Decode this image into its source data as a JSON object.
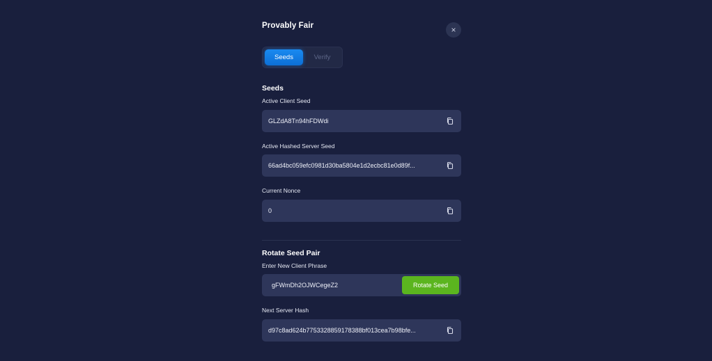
{
  "modal": {
    "title": "Provably Fair",
    "close_label": "×"
  },
  "tabs": [
    {
      "label": "Seeds",
      "active": true
    },
    {
      "label": "Verify",
      "active": false
    }
  ],
  "seeds": {
    "section_title": "Seeds",
    "client_seed_label": "Active Client Seed",
    "client_seed_value": "GLZdA8Tn94hFDWdi",
    "hashed_server_seed_label": "Active Hashed Server Seed",
    "hashed_server_seed_value": "66ad4bc059efc0981d30ba5804e1d2ecbc81e0d89f...",
    "nonce_label": "Current Nonce",
    "nonce_value": "0"
  },
  "rotate": {
    "section_title": "Rotate Seed Pair",
    "new_phrase_label": "Enter New Client Phrase",
    "new_phrase_value": "gFWmDh2OJWCegeZ2",
    "rotate_button_label": "Rotate Seed",
    "next_hash_label": "Next Server Hash",
    "next_hash_value": "d97c8ad624b7753328859178388bf013cea7b98bfe..."
  },
  "colors": {
    "background": "#191f3d",
    "field": "#2e365a",
    "accent_blue": "#1a8af0",
    "accent_green": "#5bb51f"
  },
  "icons": {
    "copy": "copy-icon",
    "close": "close-icon"
  }
}
